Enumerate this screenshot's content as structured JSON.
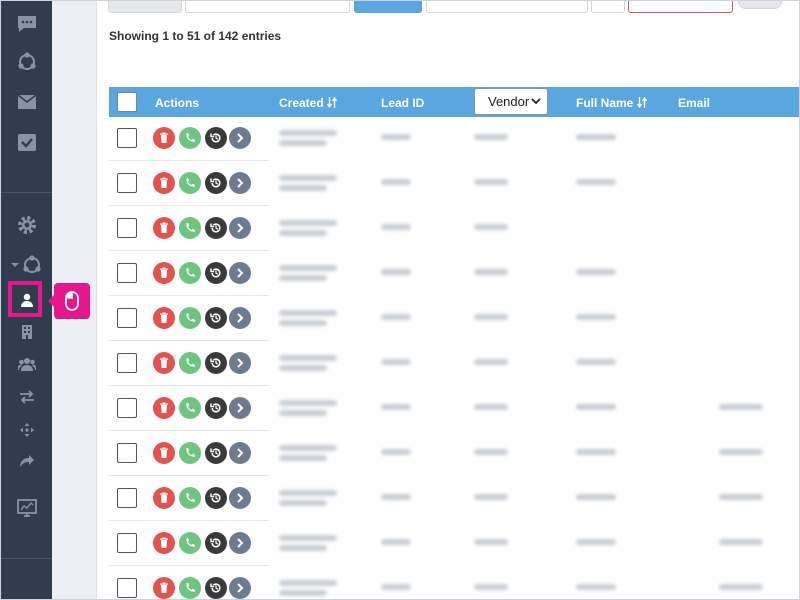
{
  "header_text": {
    "showing": "Showing 1 to 51 of 142 entries"
  },
  "table": {
    "columns": {
      "actions": "Actions",
      "created": "Created",
      "lead_id": "Lead ID",
      "vendor_select_value": "Vendor",
      "full_name": "Full Name",
      "email": "Email"
    },
    "sort_icon": "sort-arrows-icon",
    "row_count_visible": 11
  },
  "callout": {
    "icon": "mouse-icon"
  },
  "colors": {
    "sidebar": "#2f3d4e",
    "table_header": "#5aa6e0",
    "delete": "#e2534f",
    "call": "#6dc580",
    "history": "#3a3a3a",
    "goto": "#6c7b8f",
    "highlight": "#e8168d"
  }
}
